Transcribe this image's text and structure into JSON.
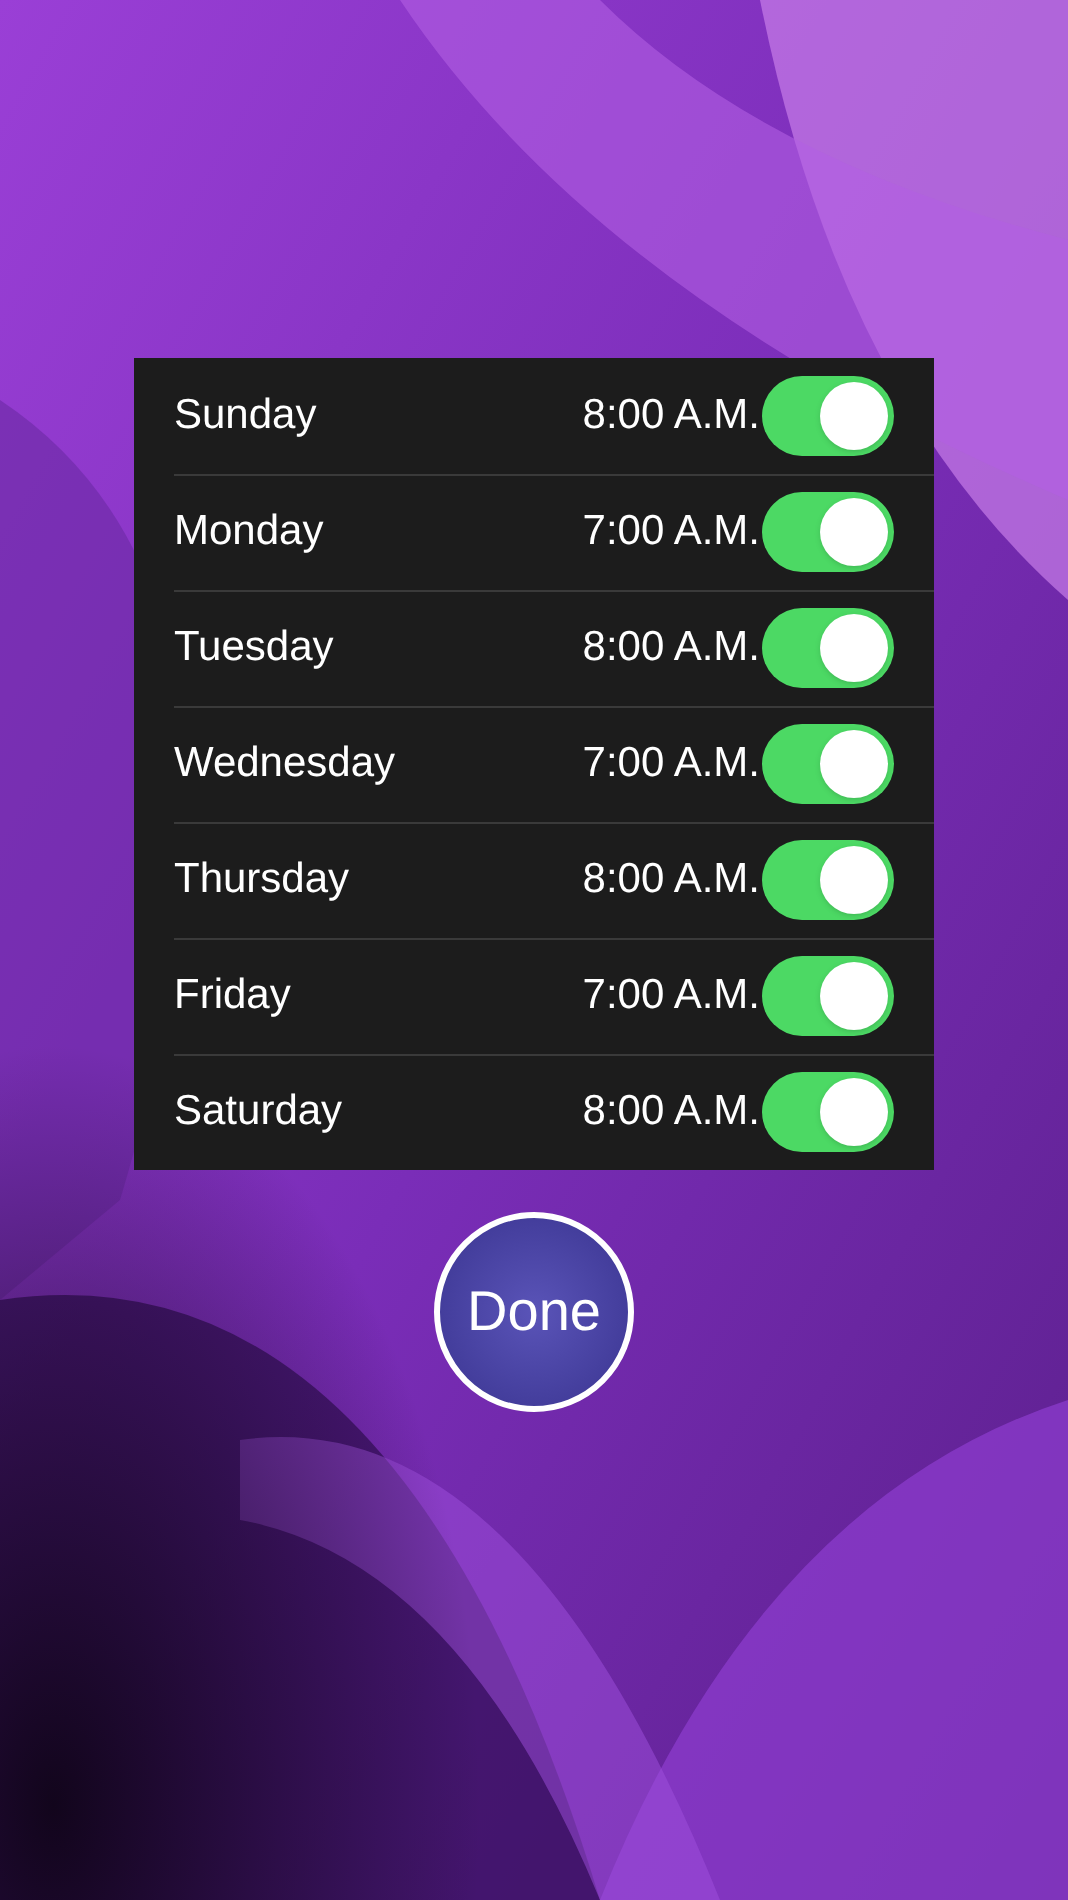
{
  "days": [
    {
      "name": "Sunday",
      "time": "8:00 A.M.",
      "on": true
    },
    {
      "name": "Monday",
      "time": "7:00 A.M.",
      "on": true
    },
    {
      "name": "Tuesday",
      "time": "8:00 A.M.",
      "on": true
    },
    {
      "name": "Wednesday",
      "time": "7:00 A.M.",
      "on": true
    },
    {
      "name": "Thursday",
      "time": "8:00 A.M.",
      "on": true
    },
    {
      "name": "Friday",
      "time": "7:00 A.M.",
      "on": true
    },
    {
      "name": "Saturday",
      "time": "8:00 A.M.",
      "on": true
    }
  ],
  "done_button": {
    "label": "Done"
  }
}
